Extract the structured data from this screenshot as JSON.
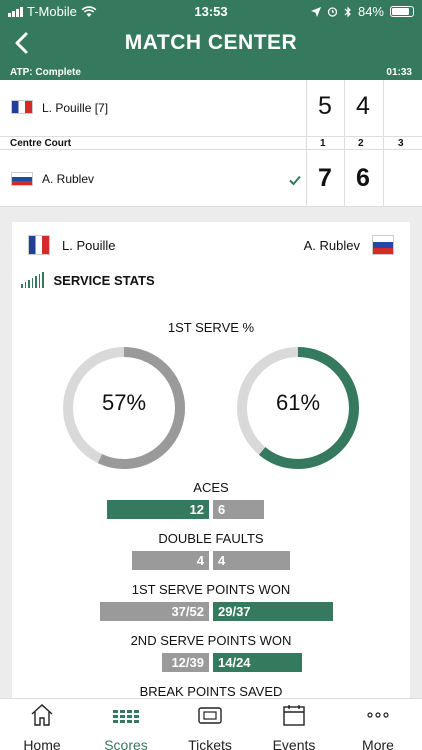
{
  "status_bar": {
    "carrier": "T-Mobile",
    "time": "13:53",
    "battery": "84%"
  },
  "header": {
    "title": "MATCH CENTER"
  },
  "match": {
    "status": "ATP: Complete",
    "duration": "01:33",
    "court": "Centre Court",
    "set_numbers": [
      "1",
      "2",
      "3"
    ]
  },
  "players": [
    {
      "name": "L. Pouille [7]",
      "short": "L. Pouille",
      "country": "france",
      "sets": [
        "5",
        "4",
        ""
      ],
      "winner": false
    },
    {
      "name": "A. Rublev",
      "short": "A. Rublev",
      "country": "russia",
      "sets": [
        "7",
        "6",
        ""
      ],
      "winner": true
    }
  ],
  "service_stats": {
    "heading": "SERVICE STATS",
    "first_serve": {
      "title": "1ST SERVE %",
      "p1_percent": 57,
      "p2_percent": 61,
      "p1_label": "57%",
      "p2_label": "61%"
    },
    "rows": [
      {
        "label": "ACES",
        "p1": "12",
        "p2": "6",
        "p1_share": 0.67,
        "p2_share": 0.33
      },
      {
        "label": "DOUBLE FAULTS",
        "p1": "4",
        "p2": "4",
        "p1_share": 0.5,
        "p2_share": 0.5
      },
      {
        "label": "1ST SERVE POINTS WON",
        "p1": "37/52",
        "p2": "29/37",
        "p1_value": 71,
        "p2_value": 78
      },
      {
        "label": "2ND SERVE POINTS WON",
        "p1": "12/39",
        "p2": "14/24",
        "p1_value": 31,
        "p2_value": 58
      },
      {
        "label": "BREAK POINTS SAVED"
      }
    ]
  },
  "colors": {
    "accent": "#357a5f",
    "loser_bar": "#9a9a9a",
    "ring_track": "#d9d9d9"
  },
  "tabs": [
    {
      "label": "Home",
      "icon": "home-icon",
      "active": false
    },
    {
      "label": "Scores",
      "icon": "scores-grid-icon",
      "active": true
    },
    {
      "label": "Tickets",
      "icon": "ticket-icon",
      "active": false
    },
    {
      "label": "Events",
      "icon": "calendar-icon",
      "active": false
    },
    {
      "label": "More",
      "icon": "more-dots-icon",
      "active": false
    }
  ]
}
